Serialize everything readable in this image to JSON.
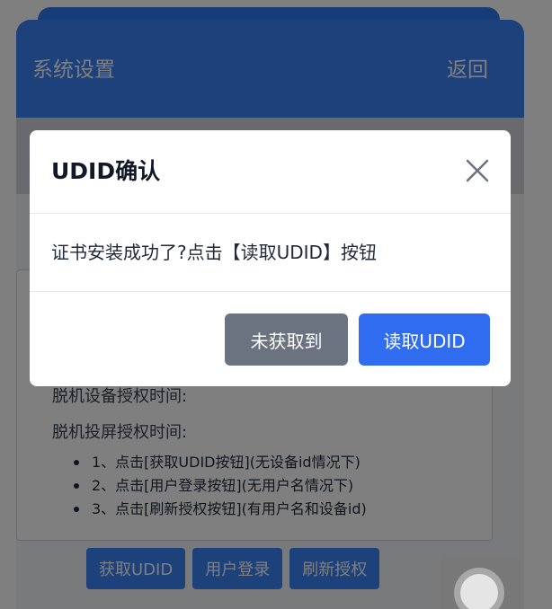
{
  "header": {
    "title": "系统设置",
    "back_label": "返回"
  },
  "info": {
    "offline_device_label": "脱机设备授权时间:",
    "offline_cast_label": "脱机投屏授权时间:",
    "steps": [
      "1、点击[获取UDID按钮](无设备id情况下)",
      "2、点击[用户登录按钮](无用户名情况下)",
      "3、点击[刷新授权按钮](有用户名和设备id)"
    ]
  },
  "actions": {
    "get_udid": "获取UDID",
    "user_login": "用户登录",
    "refresh_auth": "刷新授权"
  },
  "modal": {
    "title": "UDID确认",
    "message": "证书安装成功了?点击【读取UDID】按钮",
    "secondary_button": "未获取到",
    "primary_button": "读取UDID",
    "close_icon": "close-icon"
  },
  "colors": {
    "header_blue": "#3b82f6",
    "primary_button": "#2f6cf0",
    "secondary_button": "#6b7280"
  }
}
